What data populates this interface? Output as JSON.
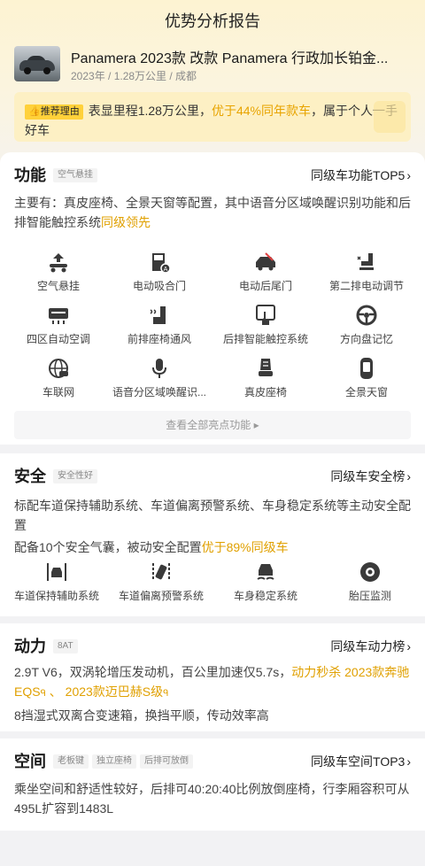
{
  "page": {
    "title": "优势分析报告"
  },
  "car": {
    "name": "Panamera 2023款 改款 Panamera 行政加长铂金...",
    "meta": "2023年 / 1.28万公里 / 成都"
  },
  "reason": {
    "badge": "推荐理由",
    "text_before": "表显里程1.28万公里，",
    "highlight": "优于44%同年款车",
    "text_after": "，属于个人一手好车"
  },
  "function": {
    "title": "功能",
    "tag": "空气悬挂",
    "rank": "同级车功能TOP5",
    "desc": "主要有：真皮座椅、全景天窗等配置，其中语音分区域唤醒识别功能和后排智能触控系统",
    "desc_highlight": "同级领先",
    "features": [
      {
        "label": "空气悬挂",
        "icon": "air-suspension-icon"
      },
      {
        "label": "电动吸合门",
        "icon": "soft-close-door-icon"
      },
      {
        "label": "电动后尾门",
        "icon": "power-tailgate-icon"
      },
      {
        "label": "第二排电动调节",
        "icon": "second-row-seat-icon"
      },
      {
        "label": "四区自动空调",
        "icon": "climate-control-icon"
      },
      {
        "label": "前排座椅通风",
        "icon": "seat-ventilation-icon"
      },
      {
        "label": "后排智能触控系统",
        "icon": "touch-control-icon"
      },
      {
        "label": "方向盘记忆",
        "icon": "steering-wheel-icon"
      },
      {
        "label": "车联网",
        "icon": "connected-car-icon"
      },
      {
        "label": "语音分区域唤醒识...",
        "icon": "microphone-icon"
      },
      {
        "label": "真皮座椅",
        "icon": "leather-seat-icon"
      },
      {
        "label": "全景天窗",
        "icon": "panoramic-roof-icon"
      }
    ],
    "view_all": "查看全部亮点功能"
  },
  "safety": {
    "title": "安全",
    "tag": "安全性好",
    "rank": "同级车安全榜",
    "line1": "标配车道保持辅助系统、车道偏离预警系统、车身稳定系统等主动安全配置",
    "line2_before": "配备10个安全气囊，被动安全配置",
    "line2_highlight": "优于89%同级车",
    "features": [
      {
        "label": "车道保持辅助系统",
        "icon": "lane-keep-icon"
      },
      {
        "label": "车道偏离预警系统",
        "icon": "lane-departure-icon"
      },
      {
        "label": "车身稳定系统",
        "icon": "stability-control-icon"
      },
      {
        "label": "胎压监测",
        "icon": "tire-pressure-icon"
      }
    ]
  },
  "power": {
    "title": "动力",
    "tag": "8AT",
    "rank": "同级车动力榜",
    "line1_before": "2.9T V6，双涡轮增压发动机，百公里加速仅5.7s，",
    "line1_highlight": "动力秒杀 2023款奔驰",
    "line2_link1": "EQS",
    "line2_sep": " 、 ",
    "line2_link2": "2023款迈巴赫S级",
    "line3": "8挡湿式双离合变速箱，换挡平顺，传动效率高"
  },
  "space": {
    "title": "空间",
    "tags": [
      "老板键",
      "独立座椅",
      "后排可放倒"
    ],
    "rank": "同级车空间TOP3",
    "line1": "乘坐空间和舒适性较好，后排可40:20:40比例放倒座椅，行李厢容积可从",
    "line2": "495L扩容到1483L"
  },
  "colors": {
    "accent": "#e8a400",
    "badge": "#ffd13a"
  }
}
